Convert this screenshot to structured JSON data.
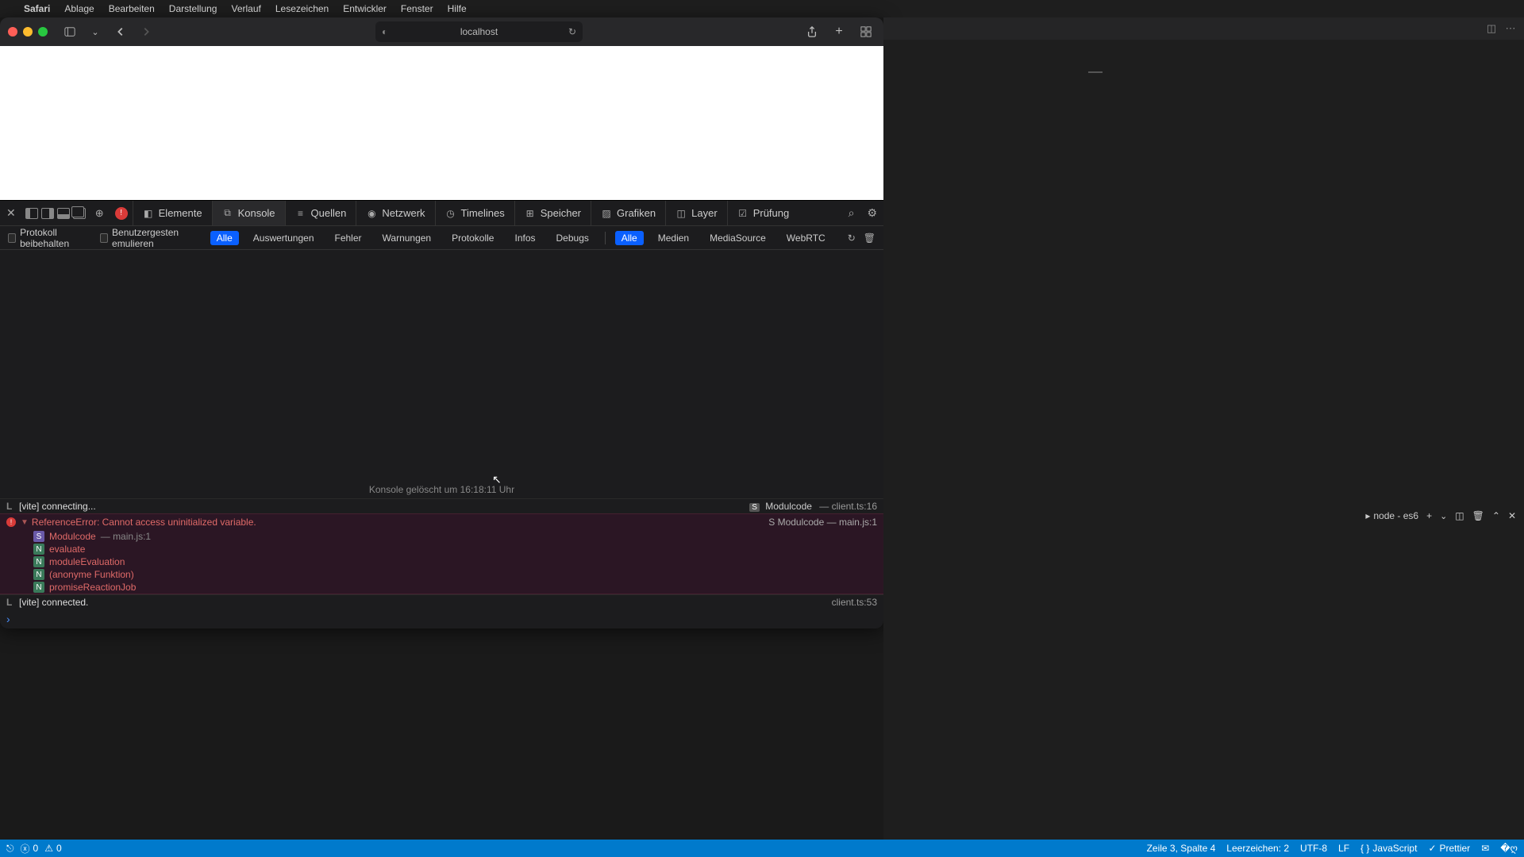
{
  "menubar": {
    "apple": "",
    "app": "Safari",
    "items": [
      "Ablage",
      "Bearbeiten",
      "Darstellung",
      "Verlauf",
      "Lesezeichen",
      "Entwickler",
      "Fenster",
      "Hilfe"
    ]
  },
  "safari": {
    "url": "localhost"
  },
  "devtools": {
    "error_count": "!",
    "tabs": [
      "Elemente",
      "Konsole",
      "Quellen",
      "Netzwerk",
      "Timelines",
      "Speicher",
      "Grafiken",
      "Layer",
      "Prüfung"
    ],
    "active_tab": "Konsole",
    "filters": {
      "preserve": "Protokoll beibehalten",
      "emulate": "Benutzergesten emulieren",
      "levels": [
        "Alle",
        "Auswertungen",
        "Fehler",
        "Warnungen",
        "Protokolle",
        "Infos",
        "Debugs"
      ],
      "levels_active": "Alle",
      "media": [
        "Alle",
        "Medien",
        "MediaSource",
        "WebRTC"
      ],
      "media_active": "Alle"
    },
    "console": {
      "cleared": "Konsole gelöscht um 16:18:11 Uhr",
      "line1": {
        "msg": "[vite] connecting...",
        "modlabel": "Modulcode",
        "src": "client.ts:16"
      },
      "error": {
        "msg": "ReferenceError: Cannot access uninitialized variable.",
        "modlabel": "Modulcode",
        "src": "main.js:1",
        "stack": [
          {
            "badge": "S",
            "name": "Modulcode",
            "loc": "main.js:1"
          },
          {
            "badge": "N",
            "name": "evaluate",
            "loc": ""
          },
          {
            "badge": "N",
            "name": "moduleEvaluation",
            "loc": ""
          },
          {
            "badge": "N",
            "name": "(anonyme Funktion)",
            "loc": ""
          },
          {
            "badge": "N",
            "name": "promiseReactionJob",
            "loc": ""
          }
        ]
      },
      "line2": {
        "msg": "[vite] connected.",
        "src": "client.ts:53"
      }
    }
  },
  "vscode": {
    "terminal": "node - es6"
  },
  "statusbar": {
    "errors": "0",
    "warnings": "0",
    "cursor": "Zeile 3, Spalte 4",
    "spaces": "Leerzeichen: 2",
    "encoding": "UTF-8",
    "eol": "LF",
    "lang": "JavaScript",
    "prettier": "Prettier"
  }
}
